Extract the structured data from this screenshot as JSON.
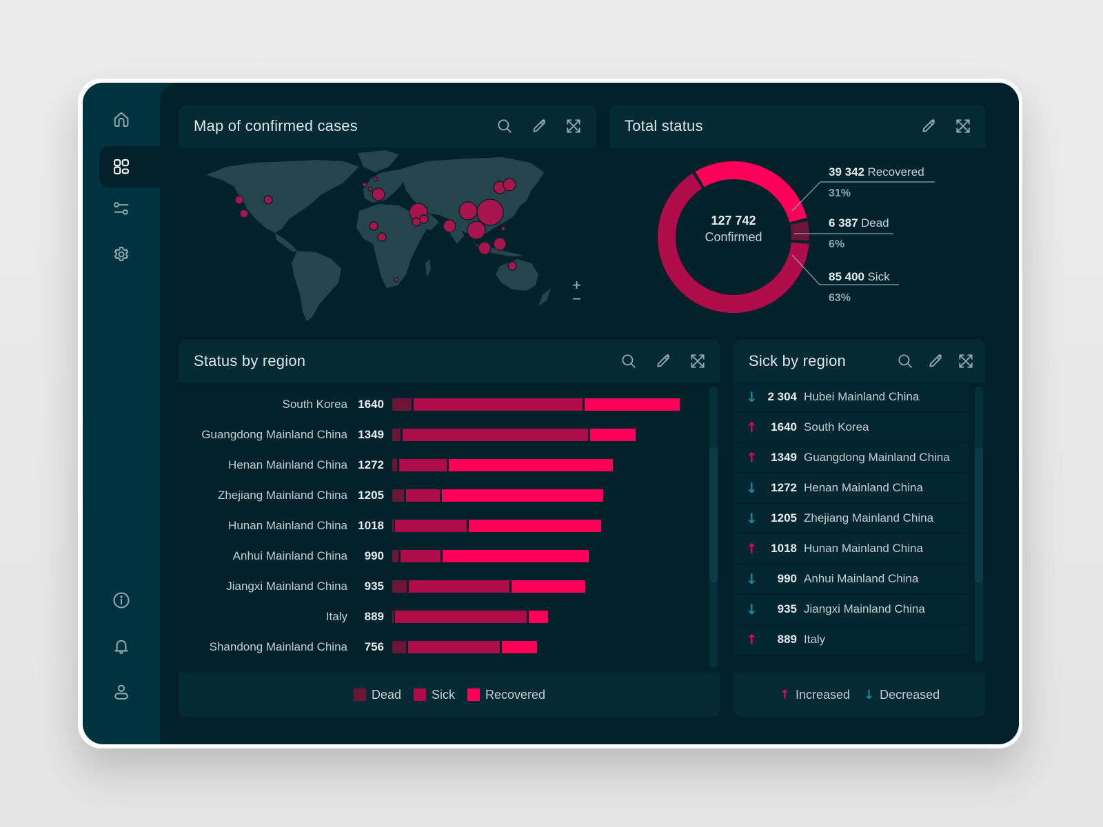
{
  "colors": {
    "dead": "#6b1538",
    "sick": "#b00b4a",
    "recovered": "#ff0058",
    "increased": "#e0094f",
    "decreased": "#1a8aa3",
    "land": "#25444c",
    "bubble": "#a8154e"
  },
  "sidebar": {
    "top_items": [
      {
        "icon": "home-icon",
        "active": false
      },
      {
        "icon": "dashboard-grid-icon",
        "active": true
      },
      {
        "icon": "sliders-icon",
        "active": false
      },
      {
        "icon": "gear-icon",
        "active": false
      }
    ],
    "bottom_items": [
      {
        "icon": "info-icon"
      },
      {
        "icon": "bell-icon"
      },
      {
        "icon": "user-icon"
      }
    ]
  },
  "map_card": {
    "title": "Map of confirmed cases",
    "actions": [
      "search-icon",
      "pencil-icon",
      "expand-icon"
    ],
    "zoom_in": "+",
    "zoom_out": "−"
  },
  "total_card": {
    "title": "Total status",
    "actions": [
      "pencil-icon",
      "expand-icon"
    ],
    "center_value": "127 742",
    "center_label": "Confirmed",
    "recovered": {
      "value": "39 342",
      "label": "Recovered",
      "pct": "31%"
    },
    "dead": {
      "value": "6 387",
      "label": "Dead",
      "pct": "6%"
    },
    "sick": {
      "value": "85 400",
      "label": "Sick",
      "pct": "63%"
    }
  },
  "status_card": {
    "title": "Status by region",
    "actions": [
      "search-icon",
      "pencil-icon",
      "expand-icon"
    ],
    "legend": {
      "dead": "Dead",
      "sick": "Sick",
      "recovered": "Recovered"
    }
  },
  "sick_card": {
    "title": "Sick by region",
    "actions": [
      "search-icon",
      "pencil-icon",
      "expand-icon"
    ],
    "rows": [
      {
        "trend": "down",
        "value": "2 304",
        "name": "Hubei Mainland China"
      },
      {
        "trend": "up",
        "value": "1640",
        "name": "South Korea"
      },
      {
        "trend": "up",
        "value": "1349",
        "name": "Guangdong Mainland China"
      },
      {
        "trend": "down",
        "value": "1272",
        "name": "Henan Mainland China"
      },
      {
        "trend": "down",
        "value": "1205",
        "name": "Zhejiang Mainland China"
      },
      {
        "trend": "up",
        "value": "1018",
        "name": "Hunan Mainland China"
      },
      {
        "trend": "down",
        "value": "990",
        "name": "Anhui Mainland China"
      },
      {
        "trend": "down",
        "value": "935",
        "name": "Jiangxi Mainland China"
      },
      {
        "trend": "up",
        "value": "889",
        "name": "Italy"
      }
    ],
    "legend": {
      "increased": "Increased",
      "decreased": "Decreased"
    },
    "arrow_up": "↑",
    "arrow_down": "↓"
  },
  "chart_data": [
    {
      "type": "pie",
      "title": "Total status",
      "center": "127 742 Confirmed",
      "categories": [
        "Recovered",
        "Dead",
        "Sick"
      ],
      "values": [
        39342,
        6387,
        85400
      ],
      "percentages": [
        31,
        6,
        63
      ]
    },
    {
      "type": "bar",
      "title": "Status by region",
      "orientation": "horizontal-stacked",
      "categories": [
        "South Korea",
        "Guangdong Mainland China",
        "Henan Mainland China",
        "Zhejiang Mainland China",
        "Hunan Mainland China",
        "Anhui Mainland China",
        "Jiangxi Mainland China",
        "Italy",
        "Shandong Mainland China"
      ],
      "totals": [
        1640,
        1349,
        1272,
        1205,
        1018,
        990,
        935,
        889,
        756
      ],
      "series": [
        {
          "name": "Dead",
          "values": [
            120,
            60,
            40,
            80,
            15,
            45,
            95,
            15,
            90
          ]
        },
        {
          "name": "Sick",
          "values": [
            970,
            1060,
            280,
            200,
            420,
            240,
            580,
            760,
            530
          ]
        },
        {
          "name": "Recovered",
          "values": [
            550,
            270,
            940,
            925,
            760,
            840,
            430,
            120,
            210
          ]
        }
      ],
      "legend": "bottom"
    },
    {
      "type": "scatter",
      "title": "Map of confirmed cases",
      "note": "Bubble map; bubble sizes relative",
      "points": [
        {
          "region": "US West",
          "size": "small"
        },
        {
          "region": "US East",
          "size": "small"
        },
        {
          "region": "Mexico",
          "size": "small"
        },
        {
          "region": "UK",
          "size": "tiny"
        },
        {
          "region": "France",
          "size": "tiny"
        },
        {
          "region": "Germany",
          "size": "tiny"
        },
        {
          "region": "Italy",
          "size": "medium"
        },
        {
          "region": "West Africa",
          "size": "small"
        },
        {
          "region": "Nigeria",
          "size": "small"
        },
        {
          "region": "South Africa",
          "size": "tiny"
        },
        {
          "region": "Iran",
          "size": "large"
        },
        {
          "region": "Gulf",
          "size": "small"
        },
        {
          "region": "UAE",
          "size": "small"
        },
        {
          "region": "India/Bangladesh",
          "size": "medium"
        },
        {
          "region": "China West",
          "size": "large"
        },
        {
          "region": "China Central",
          "size": "xlarge"
        },
        {
          "region": "Korea",
          "size": "medium"
        },
        {
          "region": "Japan",
          "size": "medium"
        },
        {
          "region": "Southeast Asia",
          "size": "large"
        },
        {
          "region": "Philippines",
          "size": "tiny"
        },
        {
          "region": "Malaysia",
          "size": "medium"
        },
        {
          "region": "Indonesia",
          "size": "medium"
        },
        {
          "region": "North Australia",
          "size": "small"
        }
      ]
    }
  ]
}
